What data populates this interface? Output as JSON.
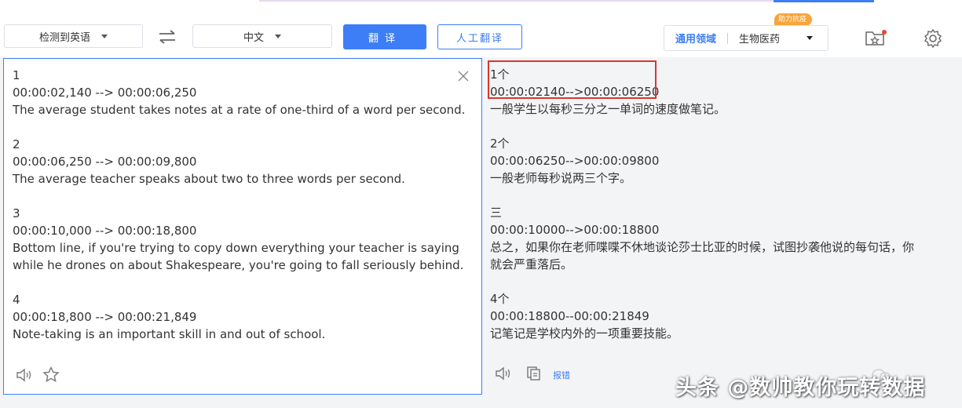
{
  "toolbar": {
    "source_lang": "检测到英语",
    "target_lang": "中文",
    "translate_label": "翻译",
    "human_translate_label": "人工翻译",
    "domain_label": "通用领域",
    "domain_value": "生物医药",
    "badge_label": "助力抗疫"
  },
  "source": {
    "lines": [
      "1",
      "00:00:02,140 --> 00:00:06,250",
      "The average student takes notes at a rate of one-third of a word per second.",
      "",
      "2",
      "00:00:06,250 --> 00:00:09,800",
      "The average teacher speaks about two to three words per second.",
      "",
      "3",
      "00:00:10,000 --> 00:00:18,800",
      "Bottom line, if you're trying to copy down everything your teacher is saying",
      "while he drones on about Shakespeare, you're going to fall seriously behind.",
      "",
      "4",
      "00:00:18,800 --> 00:00:21,849",
      "Note-taking is an important skill in and out of school."
    ]
  },
  "result": {
    "lines": [
      "1个",
      "00:00:02140-->00:00:06250",
      "一般学生以每秒三分之一单词的速度做笔记。",
      "",
      "2个",
      "00:00:06250-->00:00:09800",
      "一般老师每秒说两三个字。",
      "",
      "三",
      "00:00:10000-->00:00:18800",
      "总之，如果你在老师喋喋不休地谈论莎士比亚的时候，试图抄袭他说的每句话，你",
      "就会严重落后。",
      "",
      "4个",
      "00:00:18800--00:00:21849",
      "记笔记是学校内外的一项重要技能。"
    ],
    "report_label": "报错"
  },
  "watermark": "头条 @数帅教你玩转数据",
  "colors": {
    "accent": "#3d7ef6",
    "highlight": "#d9372f",
    "badge": "#f7a53a"
  }
}
